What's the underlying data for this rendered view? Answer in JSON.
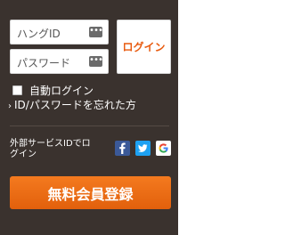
{
  "login": {
    "id_placeholder": "ハングID",
    "password_placeholder": "パスワード",
    "login_button": "ログイン",
    "auto_login_label": "自動ログイン",
    "forgot_link": "ID/パスワードを忘れた方"
  },
  "external": {
    "label": "外部サービスIDでログイン",
    "services": [
      "facebook-icon",
      "twitter-icon",
      "google-icon"
    ]
  },
  "register_button": "無料会員登録",
  "colors": {
    "panel_bg": "#3a322e",
    "accent": "#e85a0e",
    "register_bg": "#f06f18"
  }
}
